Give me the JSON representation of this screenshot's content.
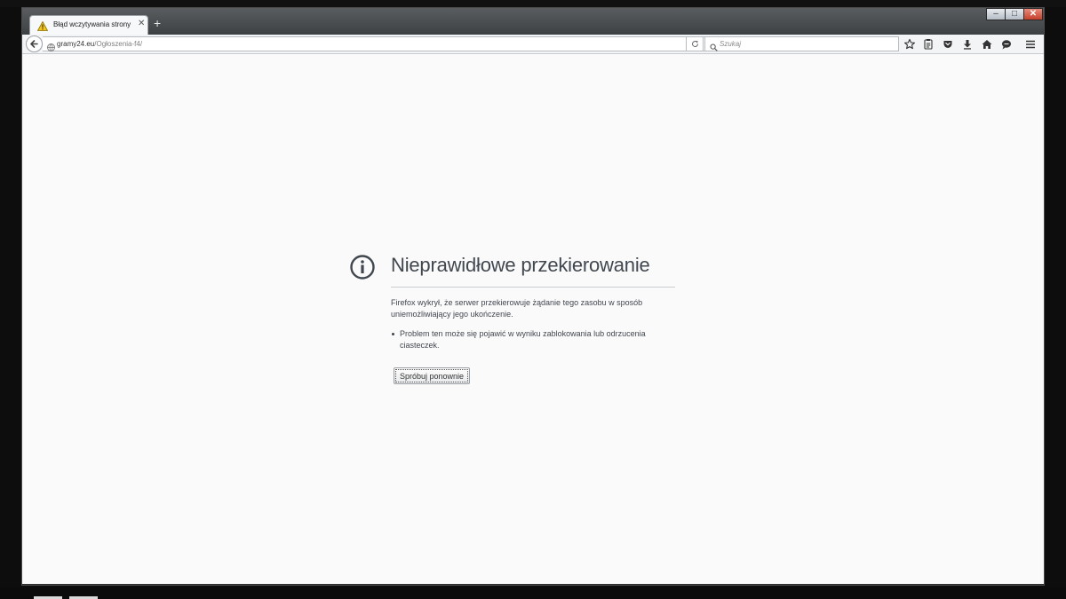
{
  "browser": {
    "tab": {
      "title": "Błąd wczytywania strony"
    },
    "new_tab_label": "+",
    "url": {
      "domain": "gramy24.eu",
      "path": "/Ogłoszenia-f4/"
    },
    "search": {
      "placeholder": "Szukaj"
    },
    "toolbar_icons": [
      "bookmark-star-icon",
      "reading-list-icon",
      "pocket-icon",
      "download-icon",
      "home-icon",
      "chat-icon",
      "menu-icon"
    ],
    "window_controls": {
      "minimize": "–",
      "maximize": "□",
      "close": "✕"
    }
  },
  "error_page": {
    "icon": "info-icon",
    "title": "Nieprawidłowe przekierowanie",
    "description": "Firefox wykrył, że serwer przekierowuje żądanie tego zasobu w sposób uniemożliwiający jego ukończenie.",
    "bullets": [
      "Problem ten może się pojawić w wyniku zablokowania lub odrzucenia ciasteczek."
    ],
    "retry_button": "Spróbuj ponownie"
  },
  "colors": {
    "text": "#41474e",
    "page_bg": "#fafafb",
    "warning": "#f5c518"
  }
}
